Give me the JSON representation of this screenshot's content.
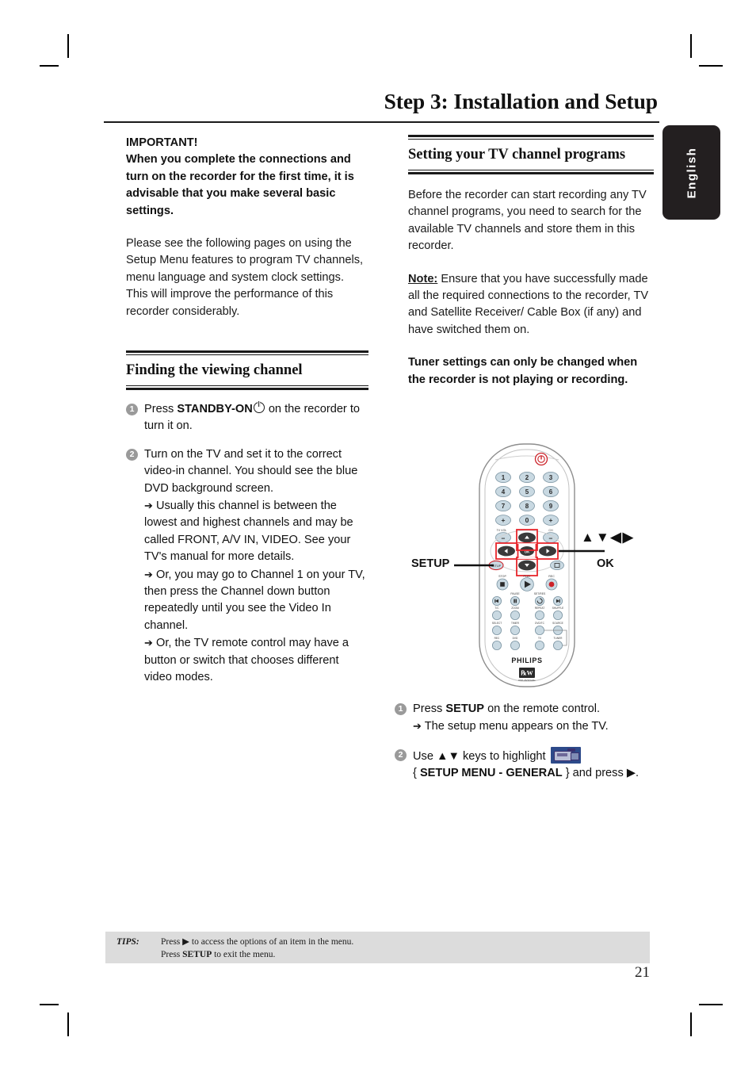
{
  "page": {
    "title": "Step 3: Installation and Setup",
    "language_tab": "English",
    "page_number": "21"
  },
  "left_column": {
    "important_heading": "IMPORTANT!",
    "important_body": "When you complete the connections and turn on the recorder for the first time, it is advisable that you make several basic settings.",
    "intro_paragraph": "Please see the following pages on using the Setup Menu features to program TV channels, menu language and system clock settings. This will improve the performance of this recorder considerably.",
    "section": {
      "title": "Finding the viewing channel",
      "steps": [
        {
          "number": "1",
          "text_before": "Press ",
          "keyword": "STANDBY-ON",
          "text_after": " on the recorder to turn it on.",
          "arrows": []
        },
        {
          "number": "2",
          "text_before": "Turn on the TV and set it to the correct video-in channel. You should see the blue DVD background screen.",
          "keyword": "",
          "text_after": "",
          "arrows": [
            "Usually this channel is between the lowest and highest channels and may be called FRONT, A/V IN, VIDEO. See your TV's manual for more details.",
            "Or, you may go to Channel 1 on your TV, then press the Channel down button repeatedly until you see the Video In channel.",
            "Or, the TV remote control may have a button or switch that chooses different video modes."
          ]
        }
      ]
    }
  },
  "right_column": {
    "section_title": "Setting your TV channel programs",
    "intro_paragraph": "Before the recorder can start recording any TV channel programs, you need to search for the available TV channels and store them in this recorder.",
    "note_label": "Note:",
    "note_body": " Ensure that you have successfully made all the required connections to the recorder, TV and Satellite Receiver/ Cable Box (if any) and have switched them on.",
    "warning_bold": "Tuner settings can only be changed when the recorder is not playing or recording.",
    "steps": [
      {
        "number": "1",
        "text_before": "Press ",
        "keyword": "SETUP",
        "text_after": " on the remote control.",
        "arrows": [
          "The setup menu appears on the TV."
        ]
      },
      {
        "number": "2",
        "text_before": "Use ▲▼ keys to highlight ",
        "icon": "camcorder-icon",
        "menu_open": "{ ",
        "menu_label": "SETUP MENU - GENERAL",
        "menu_close": " } and press ▶.",
        "arrows": []
      }
    ]
  },
  "remote_illustration": {
    "brand": "PHILIPS",
    "logo_text": "RW",
    "logo_subtext": "DVD+ReWritable",
    "callouts": {
      "setup": "SETUP",
      "ok": "OK",
      "arrows": "▲▼◀▶"
    },
    "numeric_keys": [
      "1",
      "2",
      "3",
      "4",
      "5",
      "6",
      "7",
      "8",
      "9",
      "0"
    ],
    "plus_minus_left_label": "TV VOL",
    "plus_minus_right_label": "CH",
    "transport_labels": [
      "STOP",
      "PLAY",
      "REC"
    ],
    "secondary_labels": [
      "PAUSE",
      "SET/RES"
    ],
    "row_labels_1": [
      "T/C",
      "ZOOM",
      "REPEAT",
      "SHUFFLE"
    ],
    "row_labels_2": [
      "SELECT",
      "TIMER",
      "DVD/TC",
      "SOURCE"
    ],
    "row_labels_3": [
      "REC",
      "DVD",
      "TV",
      "TUNER"
    ],
    "power_color": "#cc2229",
    "rec_color": "#cc2229",
    "highlight_color": "#e8262c",
    "button_fill": "#c9d9e2",
    "button_dark": "#3a3a3a"
  },
  "tips": {
    "label": "TIPS:",
    "line1_before": "Press ",
    "line1_arrow": "▶",
    "line1_after": " to access the options of an item in the menu.",
    "line2_before": "Press ",
    "line2_keyword": "SETUP",
    "line2_after": " to exit the menu."
  },
  "colors": {
    "tips_background": "#dcdcdc",
    "tab_background": "#231f20",
    "step_bullet": "#9a9a9a"
  }
}
